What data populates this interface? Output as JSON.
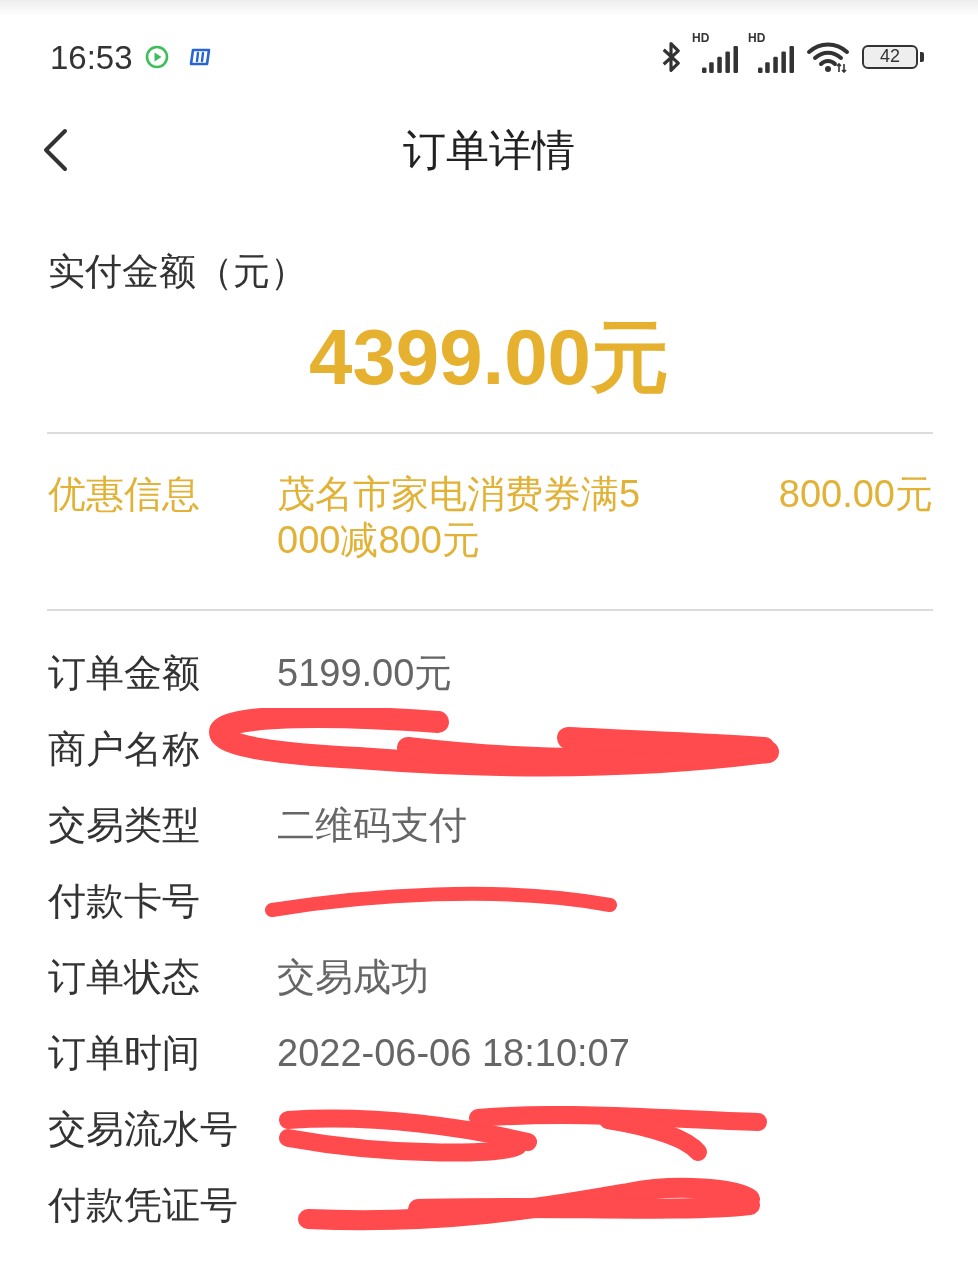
{
  "status_bar": {
    "time": "16:53",
    "signals": [
      {
        "label": "HD"
      },
      {
        "label": "HD"
      }
    ],
    "battery": "42"
  },
  "header": {
    "title": "订单详情"
  },
  "paid": {
    "label": "实付金额（元）",
    "amount": "4399.00元"
  },
  "discount": {
    "label": "优惠信息",
    "description": "茂名市家电消费券满5000减800元",
    "amount": "800.00元"
  },
  "details": [
    {
      "label": "订单金额",
      "value": "5199.00元",
      "redacted": false
    },
    {
      "label": "商户名称",
      "redacted": true
    },
    {
      "label": "交易类型",
      "value": "二维码支付",
      "redacted": false
    },
    {
      "label": "付款卡号",
      "redacted": true
    },
    {
      "label": "订单状态",
      "value": "交易成功",
      "redacted": false
    },
    {
      "label": "订单时间",
      "value": "2022-06-06 18:10:07",
      "redacted": false
    },
    {
      "label": "交易流水号",
      "redacted": true
    },
    {
      "label": "付款凭证号",
      "redacted": true
    }
  ]
}
